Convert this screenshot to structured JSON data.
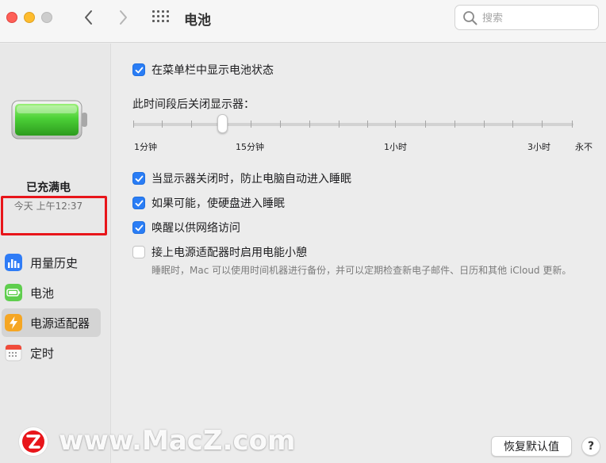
{
  "window": {
    "title": "电池"
  },
  "search": {
    "placeholder": "搜索"
  },
  "sidebar": {
    "battery_status": "已充满电",
    "battery_time": "今天 上午12:37",
    "items": [
      {
        "label": "用量历史",
        "icon": "bar-chart-icon",
        "selected": false
      },
      {
        "label": "电池",
        "icon": "battery-icon",
        "selected": false
      },
      {
        "label": "电源适配器",
        "icon": "lightning-icon",
        "selected": true
      },
      {
        "label": "定时",
        "icon": "calendar-icon",
        "selected": false
      }
    ]
  },
  "main": {
    "show_in_menubar": {
      "label": "在菜单栏中显示电池状态",
      "checked": true
    },
    "slider": {
      "label": "此时间段后关闭显示器：",
      "value": "15分钟",
      "ticks": [
        "1分钟",
        "15分钟",
        "1小时",
        "3小时",
        "永不"
      ]
    },
    "options": [
      {
        "label": "当显示器关闭时，防止电脑自动进入睡眠",
        "checked": true
      },
      {
        "label": "如果可能，使硬盘进入睡眠",
        "checked": true
      },
      {
        "label": "唤醒以供网络访问",
        "checked": true
      },
      {
        "label": "接上电源适配器时启用电能小憩",
        "checked": false
      }
    ],
    "help_text": "睡眠时，Mac 可以使用时间机器进行备份，并可以定期检查新电子邮件、日历和其他 iCloud 更新。"
  },
  "buttons": {
    "restore": "恢复默认值",
    "help": "?"
  },
  "watermark": {
    "text": "www.MacZ.com"
  },
  "colors": {
    "accent": "#2a7df5",
    "battery_green": "#4cd137",
    "highlight": "#e8151a"
  }
}
